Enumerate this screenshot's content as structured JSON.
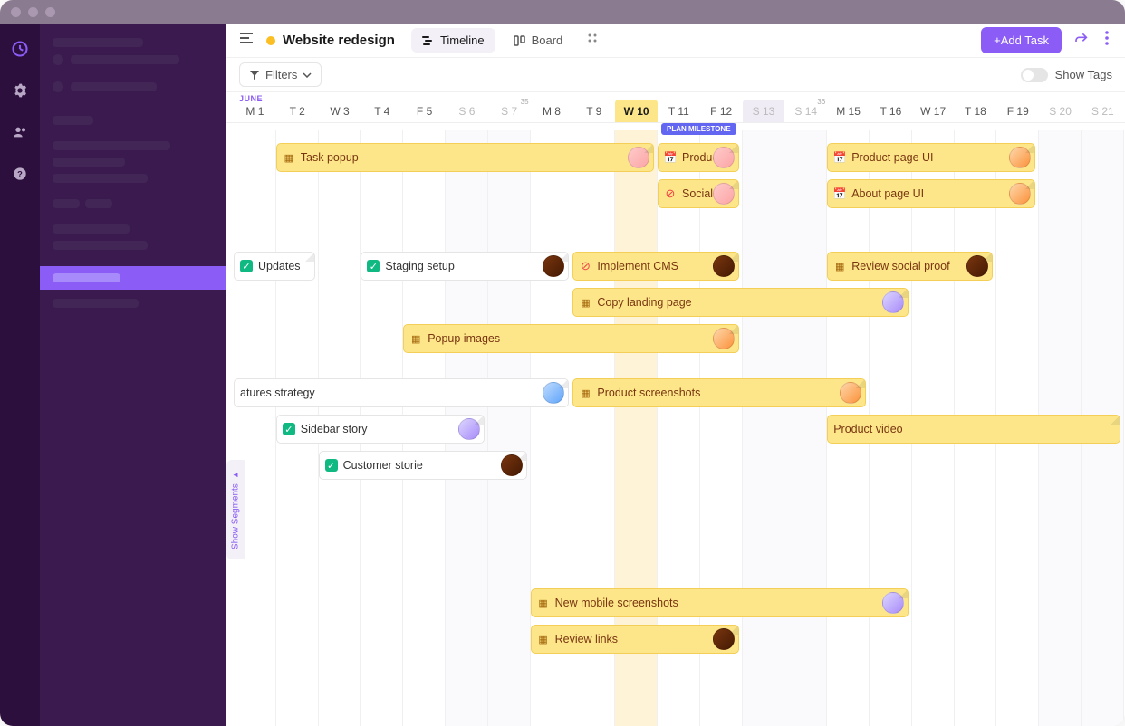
{
  "header": {
    "project_title": "Website redesign",
    "view_timeline": "Timeline",
    "view_board": "Board",
    "add_task": "+Add Task"
  },
  "filters": {
    "label": "Filters",
    "show_tags": "Show Tags"
  },
  "timeline": {
    "month": "JUNE",
    "days": [
      {
        "label": "M 1",
        "weekend": false
      },
      {
        "label": "T 2",
        "weekend": false
      },
      {
        "label": "W 3",
        "weekend": false
      },
      {
        "label": "T 4",
        "weekend": false
      },
      {
        "label": "F 5",
        "weekend": false
      },
      {
        "label": "S 6",
        "weekend": true
      },
      {
        "label": "S 7",
        "weekend": true,
        "week": "35"
      },
      {
        "label": "M 8",
        "weekend": false
      },
      {
        "label": "T 9",
        "weekend": false
      },
      {
        "label": "W 10",
        "weekend": false,
        "today": true
      },
      {
        "label": "T 11",
        "weekend": false
      },
      {
        "label": "F 12",
        "weekend": false
      },
      {
        "label": "S 13",
        "weekend": true,
        "marked": true
      },
      {
        "label": "S 14",
        "weekend": true,
        "week": "36"
      },
      {
        "label": "M 15",
        "weekend": false
      },
      {
        "label": "T 16",
        "weekend": false
      },
      {
        "label": "W 17",
        "weekend": false
      },
      {
        "label": "T 18",
        "weekend": false
      },
      {
        "label": "F 19",
        "weekend": false
      },
      {
        "label": "S 20",
        "weekend": true
      },
      {
        "label": "S 21",
        "weekend": true
      }
    ],
    "milestone_label": "PLAN MILESTONE"
  },
  "segments_label": "Show Segments",
  "tasks": [
    {
      "id": "task-popup",
      "label": "Task popup",
      "start": 1,
      "span": 9,
      "row": 0,
      "style": "yellow",
      "icon": "prog",
      "avatar": "pink"
    },
    {
      "id": "product-a",
      "label": "Produc",
      "start": 10,
      "span": 2,
      "row": 0,
      "style": "yellow",
      "icon": "cal",
      "avatar": "pink"
    },
    {
      "id": "product-page-ui",
      "label": "Product page UI",
      "start": 14,
      "span": 5,
      "row": 0,
      "style": "yellow",
      "icon": "cal",
      "avatar": "orange"
    },
    {
      "id": "social",
      "label": "Social",
      "start": 10,
      "span": 2,
      "row": 1,
      "style": "yellow",
      "icon": "block",
      "avatar": "pink"
    },
    {
      "id": "about-page-ui",
      "label": "About page UI",
      "start": 14,
      "span": 5,
      "row": 1,
      "style": "yellow",
      "icon": "cal",
      "avatar": "orange"
    },
    {
      "id": "updates",
      "label": "Updates",
      "start": 0,
      "span": 2,
      "row": 3,
      "style": "white",
      "icon": "check"
    },
    {
      "id": "staging-setup",
      "label": "Staging setup",
      "start": 3,
      "span": 5,
      "row": 3,
      "style": "white",
      "icon": "check",
      "avatar": "dark"
    },
    {
      "id": "implement-cms",
      "label": "Implement CMS",
      "start": 8,
      "span": 4,
      "row": 3,
      "style": "yellow",
      "icon": "block",
      "avatar": "dark"
    },
    {
      "id": "review-social-proof",
      "label": "Review social proof",
      "start": 14,
      "span": 4,
      "row": 3,
      "style": "yellow",
      "icon": "prog",
      "avatar": "dark"
    },
    {
      "id": "copy-landing",
      "label": "Copy landing page",
      "start": 8,
      "span": 8,
      "row": 4,
      "style": "yellow",
      "icon": "prog",
      "avatar": "purple"
    },
    {
      "id": "popup-images",
      "label": "Popup images",
      "start": 4,
      "span": 8,
      "row": 5,
      "style": "yellow",
      "icon": "prog",
      "avatar": "orange"
    },
    {
      "id": "features-strategy",
      "label": "atures strategy",
      "start": 0,
      "span": 8,
      "row": 6.5,
      "style": "white",
      "icon": "",
      "avatar": "blue"
    },
    {
      "id": "product-screenshots",
      "label": "Product screenshots",
      "start": 8,
      "span": 7,
      "row": 6.5,
      "style": "yellow",
      "icon": "prog",
      "avatar": "orange"
    },
    {
      "id": "sidebar-story",
      "label": "Sidebar story",
      "start": 1,
      "span": 5,
      "row": 7.5,
      "style": "white",
      "icon": "check",
      "avatar": "purple"
    },
    {
      "id": "product-video",
      "label": "Product video",
      "start": 14,
      "span": 7,
      "row": 7.5,
      "style": "yellow",
      "icon": ""
    },
    {
      "id": "customer-stories",
      "label": "Customer storie",
      "start": 2,
      "span": 5,
      "row": 8.5,
      "style": "white",
      "icon": "check",
      "avatar": "dark"
    },
    {
      "id": "mobile-screenshots",
      "label": "New mobile screenshots",
      "start": 7,
      "span": 9,
      "row": 12.3,
      "style": "yellow",
      "icon": "prog",
      "avatar": "purple"
    },
    {
      "id": "review-links",
      "label": "Review links",
      "start": 7,
      "span": 5,
      "row": 13.3,
      "style": "yellow",
      "icon": "prog",
      "avatar": "dark"
    }
  ]
}
